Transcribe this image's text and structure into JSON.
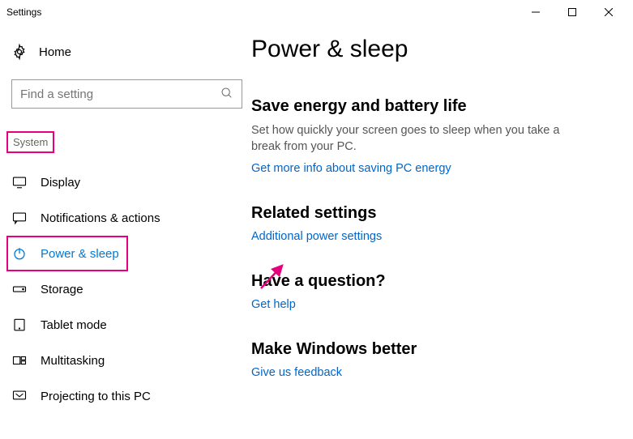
{
  "title": "Settings",
  "sidebar": {
    "home": "Home",
    "search_placeholder": "Find a setting",
    "category": "System",
    "items": [
      {
        "label": "Display"
      },
      {
        "label": "Notifications & actions"
      },
      {
        "label": "Power & sleep"
      },
      {
        "label": "Storage"
      },
      {
        "label": "Tablet mode"
      },
      {
        "label": "Multitasking"
      },
      {
        "label": "Projecting to this PC"
      }
    ]
  },
  "main": {
    "heading": "Power & sleep",
    "subhead1": "Save energy and battery life",
    "desc1": "Set how quickly your screen goes to sleep when you take a break from your PC.",
    "link1": "Get more info about saving PC energy",
    "subhead2": "Related settings",
    "link2": "Additional power settings",
    "subhead3": "Have a question?",
    "link3": "Get help",
    "subhead4": "Make Windows better",
    "link4": "Give us feedback"
  }
}
